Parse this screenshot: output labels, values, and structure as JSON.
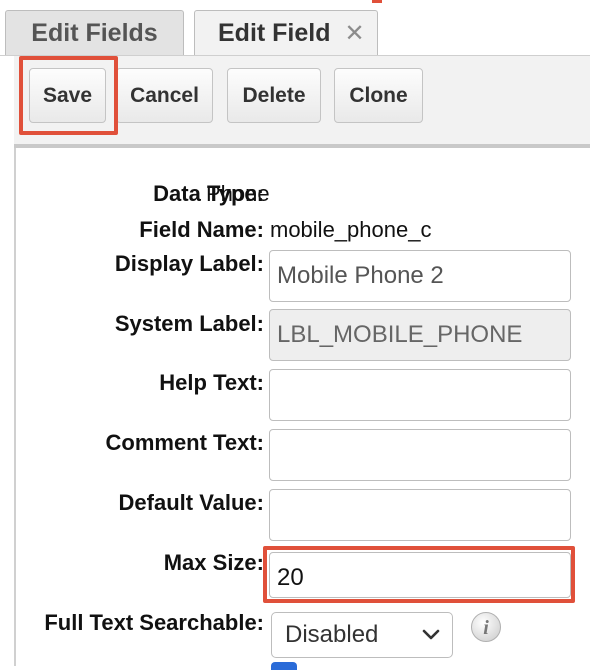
{
  "tabs": {
    "edit_fields": "Edit Fields",
    "edit_field": "Edit Field",
    "close_glyph": "✕"
  },
  "toolbar": {
    "save": "Save",
    "cancel": "Cancel",
    "delete": "Delete",
    "clone": "Clone"
  },
  "form": {
    "data_type": {
      "label": "Data Type:",
      "value": "Phone"
    },
    "field_name": {
      "label": "Field Name:",
      "value": "mobile_phone_c"
    },
    "display_label": {
      "label": "Display Label:",
      "value": "Mobile Phone 2"
    },
    "system_label": {
      "label": "System Label:",
      "value": "LBL_MOBILE_PHONE"
    },
    "help_text": {
      "label": "Help Text:",
      "value": ""
    },
    "comment_text": {
      "label": "Comment Text:",
      "value": ""
    },
    "default_value": {
      "label": "Default Value:",
      "value": ""
    },
    "max_size": {
      "label": "Max Size:",
      "value": "20"
    },
    "full_text_searchable": {
      "label": "Full Text Searchable:",
      "value": "Disabled"
    }
  },
  "icons": {
    "info": "info-icon",
    "chevron": "chevron-down-icon",
    "close": "close-icon"
  },
  "colors": {
    "highlight": "#e0503a",
    "toolbar_bg": "#f2f2f2",
    "checkbox": "#2a6bd8"
  }
}
